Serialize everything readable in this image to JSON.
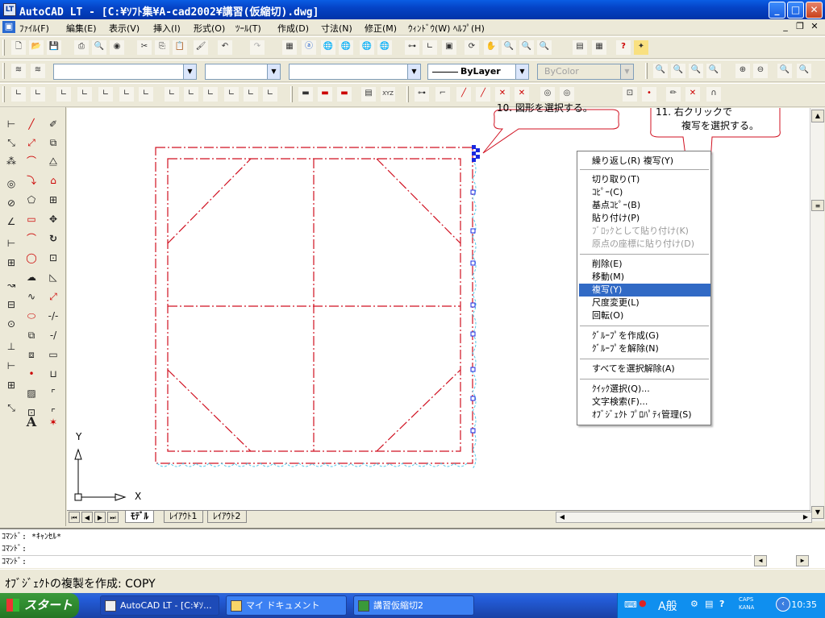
{
  "window": {
    "title": "AutoCAD LT - [C:¥ｿﾌﾄ集¥A-cad2002¥講習(仮縮切).dwg]",
    "icon": "autocad-app-icon"
  },
  "menus": [
    "ﾌｧｲﾙ(F)",
    "編集(E)",
    "表示(V)",
    "挿入(I)",
    "形式(O)",
    "ﾂｰﾙ(T)",
    "作成(D)",
    "寸法(N)",
    "修正(M)",
    "ｳｨﾝﾄﾞｳ(W)",
    "ﾍﾙﾌﾟ(H)"
  ],
  "properties_toolbar": {
    "linetype": "ByLayer",
    "color": "ByColor"
  },
  "callouts": {
    "step10": "10. 図形を選択する。",
    "step11_line1": "11. 右クリックで",
    "step11_line2": "複写を選択する。"
  },
  "context_menu": {
    "items": [
      {
        "label": "繰り返し(R) 複写(Y)",
        "state": "normal"
      },
      {
        "label": "切り取り(T)",
        "state": "normal"
      },
      {
        "label": "ｺﾋﾟｰ(C)",
        "state": "normal"
      },
      {
        "label": "基点ｺﾋﾟｰ(B)",
        "state": "normal"
      },
      {
        "label": "貼り付け(P)",
        "state": "normal"
      },
      {
        "label": "ﾌﾞﾛｯｸとして貼り付け(K)",
        "state": "disabled"
      },
      {
        "label": "原点の座標に貼り付け(D)",
        "state": "disabled"
      },
      {
        "label": "削除(E)",
        "state": "normal"
      },
      {
        "label": "移動(M)",
        "state": "normal"
      },
      {
        "label": "複写(Y)",
        "state": "selected"
      },
      {
        "label": "尺度変更(L)",
        "state": "normal"
      },
      {
        "label": "回転(O)",
        "state": "normal"
      },
      {
        "label": "ｸﾞﾙｰﾌﾟを作成(G)",
        "state": "normal"
      },
      {
        "label": "ｸﾞﾙｰﾌﾟを解除(N)",
        "state": "normal"
      },
      {
        "label": "すべてを選択解除(A)",
        "state": "normal"
      },
      {
        "label": "ｸｲｯｸ選択(Q)...",
        "state": "normal"
      },
      {
        "label": "文字検索(F)...",
        "state": "normal"
      },
      {
        "label": "ｵﾌﾞｼﾞｪｸﾄ ﾌﾟﾛﾊﾟﾃｨ管理(S)",
        "state": "normal"
      }
    ]
  },
  "ucs": {
    "y_label": "Y",
    "x_label": "X"
  },
  "layout_tabs": [
    "ﾓﾃﾞﾙ",
    "ﾚｲｱｳﾄ1",
    "ﾚｲｱｳﾄ2"
  ],
  "command_history": [
    "ｺﾏﾝﾄﾞ: *ｷｬﾝｾﾙ*",
    "ｺﾏﾝﾄﾞ:",
    "ｺﾏﾝﾄﾞ:"
  ],
  "status_text": "ｵﾌﾞｼﾞｪｸﾄの複製を作成:  COPY",
  "taskbar": {
    "start": "スタート",
    "buttons": [
      "AutoCAD LT - [C:¥ｿ...",
      "マイ ドキュメント",
      "講習仮縮切2"
    ],
    "ime": "A般",
    "caps": "CAPS",
    "kana": "KANA",
    "clock": "10:35"
  },
  "colors": {
    "drawing_line": "#d01020",
    "selection_grip": "#1a28e0",
    "highlight_dash": "#50c8e8",
    "menu_highlight": "#316ac5"
  }
}
